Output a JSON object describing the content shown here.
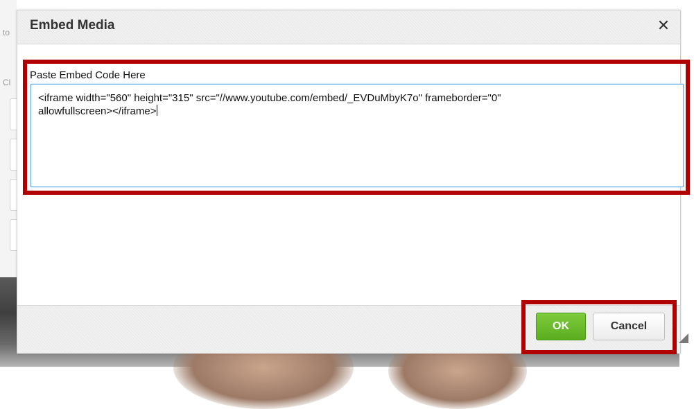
{
  "background": {
    "left_label_1": "to",
    "left_label_2": "Cl"
  },
  "dialog": {
    "title": "Embed Media",
    "close_symbol": "✕",
    "field_label": "Paste Embed Code Here",
    "embed_code": "<iframe width=\"560\" height=\"315\" src=\"//www.youtube.com/embed/_EVDuMbyK7o\" frameborder=\"0\"\nallowfullscreen></iframe>",
    "ok_label": "OK",
    "cancel_label": "Cancel"
  },
  "colors": {
    "highlight": "#b00000",
    "ok_button": "#5aad1f",
    "focus_border": "#66aee8"
  },
  "icons": {
    "close": "close-icon",
    "resize": "resize-handle-icon"
  }
}
